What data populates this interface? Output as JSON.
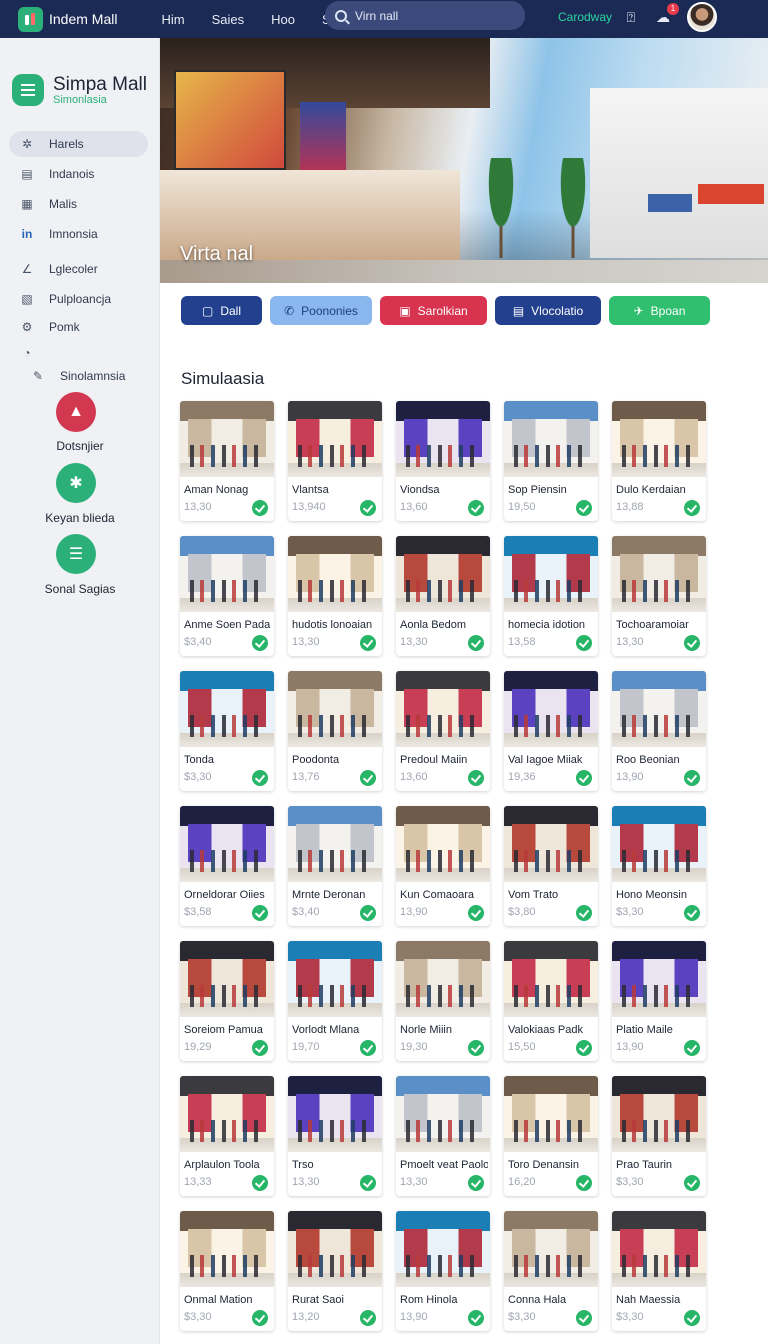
{
  "topbar": {
    "brand": "Indem Mall",
    "nav": [
      "Him",
      "Saies",
      "Hoo",
      "Soo"
    ],
    "search_value": "Virn nall",
    "user_link": "Carodway",
    "notif_count": "1"
  },
  "sidebar": {
    "title": "Simpa Mall",
    "subtitle": "Simonlasia",
    "items": [
      {
        "label": "Harels",
        "icon": "grid-icon",
        "glyph": "✲"
      },
      {
        "label": "Indanois",
        "icon": "list-icon",
        "glyph": "▤"
      },
      {
        "label": "Malis",
        "icon": "table-icon",
        "glyph": "▦"
      },
      {
        "label": "Imnonsia",
        "icon": "linkedin-icon",
        "glyph": "in"
      },
      {
        "label": "Lglecoler",
        "icon": "ruler-icon",
        "glyph": "∠"
      },
      {
        "label": "Pulploancja",
        "icon": "document-icon",
        "glyph": "▧"
      },
      {
        "label": "Pomk",
        "icon": "settings-icon",
        "glyph": "⚙"
      },
      {
        "label": "",
        "icon": "clock-icon",
        "glyph": "◔"
      },
      {
        "label": "Sinolamnsia",
        "icon": "pen-icon",
        "glyph": "✎"
      }
    ],
    "tools": [
      {
        "label": "Dotsnjier",
        "color": "#d2384f",
        "glyph": "▲"
      },
      {
        "label": "Keyan blieda",
        "color": "#2bb07a",
        "glyph": "✱"
      },
      {
        "label": "Sonal Sagias",
        "color": "#2bb07a",
        "glyph": "☰"
      }
    ]
  },
  "hero": {
    "caption": "Virta nal"
  },
  "actions": [
    {
      "label": "Dall",
      "color": "#23408e",
      "glyph": "▢",
      "w": 81
    },
    {
      "label": "Poononies",
      "color": "#8ab7ee",
      "glyph": "✆",
      "w": 102
    },
    {
      "label": "Sarolkian",
      "color": "#d83450",
      "glyph": "▣",
      "w": 107
    },
    {
      "label": "Vlocolatio",
      "color": "#23408e",
      "glyph": "▤",
      "w": 106
    },
    {
      "label": "Bpoan",
      "color": "#2fbf6e",
      "glyph": "✈",
      "w": 101
    }
  ],
  "section_title": "Simulaasia",
  "stores": [
    {
      "name": "Aman Nonag",
      "price": "13,30"
    },
    {
      "name": "Vlantsa",
      "price": "13,940"
    },
    {
      "name": "Viondsa",
      "price": "13,60"
    },
    {
      "name": "Sop Piensin",
      "price": "19,50"
    },
    {
      "name": "Dulo Kerdaian",
      "price": "13,88"
    },
    {
      "name": "Anme Soen Pada",
      "price": "$3,40"
    },
    {
      "name": "hudotis lonoaian",
      "price": "13,30"
    },
    {
      "name": "Aonla Bedom",
      "price": "13,30"
    },
    {
      "name": "homecia idotion",
      "price": "13,58"
    },
    {
      "name": "Tochoaramoiar",
      "price": "13,30"
    },
    {
      "name": "Tonda",
      "price": "$3,30"
    },
    {
      "name": "Poodonta",
      "price": "13,76"
    },
    {
      "name": "Predoul Maiin",
      "price": "13,60"
    },
    {
      "name": "Val Iagoe Miiak",
      "price": "19,36"
    },
    {
      "name": "Roo Beonian",
      "price": "13,90"
    },
    {
      "name": "Orneldorar Oiies",
      "price": "$3,58"
    },
    {
      "name": "Mrnte Deronan",
      "price": "$3,40"
    },
    {
      "name": "Kun Comaoara",
      "price": "13,90"
    },
    {
      "name": "Vom Trato",
      "price": "$3,80"
    },
    {
      "name": "Hono Meonsin",
      "price": "$3,30"
    },
    {
      "name": "Soreiom Pamua",
      "price": "19,29"
    },
    {
      "name": "Vorlodt Mlana",
      "price": "19,70"
    },
    {
      "name": "Norle Miiin",
      "price": "19,30"
    },
    {
      "name": "Valokiaas Padk",
      "price": "15,50"
    },
    {
      "name": "Platio Maile",
      "price": "13,90"
    },
    {
      "name": "Arplaulon Toola",
      "price": "13,33"
    },
    {
      "name": "Trso",
      "price": "13,30"
    },
    {
      "name": "Pmoelt veat Paolo",
      "price": "13,30"
    },
    {
      "name": "Toro Denansin",
      "price": "16,20"
    },
    {
      "name": "Prao Taurin",
      "price": "$3,30"
    },
    {
      "name": "Onmal Mation",
      "price": "$3,30"
    },
    {
      "name": "Rurat Saoi",
      "price": "13,20"
    },
    {
      "name": "Rom Hinola",
      "price": "13,90"
    },
    {
      "name": "Conna Hala",
      "price": "$3,30"
    },
    {
      "name": "Nah Maessia",
      "price": "$3,30"
    }
  ]
}
